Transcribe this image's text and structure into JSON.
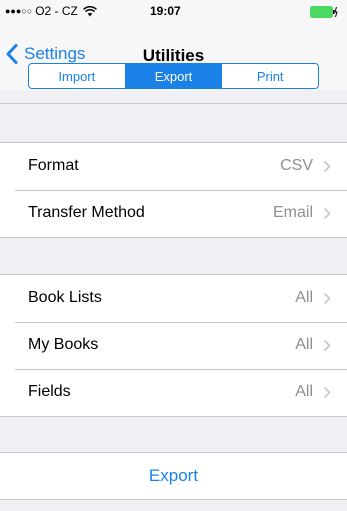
{
  "status_bar": {
    "signal": "●●●○○",
    "carrier": "O2 - CZ",
    "time": "19:07"
  },
  "nav": {
    "back_label": "Settings",
    "title": "Utilities"
  },
  "segments": [
    {
      "label": "Import",
      "selected": false
    },
    {
      "label": "Export",
      "selected": true
    },
    {
      "label": "Print",
      "selected": false
    }
  ],
  "format_group": [
    {
      "label": "Format",
      "value": "CSV"
    },
    {
      "label": "Transfer Method",
      "value": "Email"
    }
  ],
  "content_group": [
    {
      "label": "Book Lists",
      "value": "All"
    },
    {
      "label": "My Books",
      "value": "All"
    },
    {
      "label": "Fields",
      "value": "All"
    }
  ],
  "action": {
    "label": "Export"
  },
  "colors": {
    "accent": "#1a82e6",
    "background": "#efeff4",
    "battery": "#4cd964",
    "secondary_text": "#8e8e93"
  },
  "icons": {
    "back": "chevron-left-icon",
    "disclosure": "chevron-right-icon",
    "wifi": "wifi-icon",
    "battery": "battery-charging-icon"
  }
}
